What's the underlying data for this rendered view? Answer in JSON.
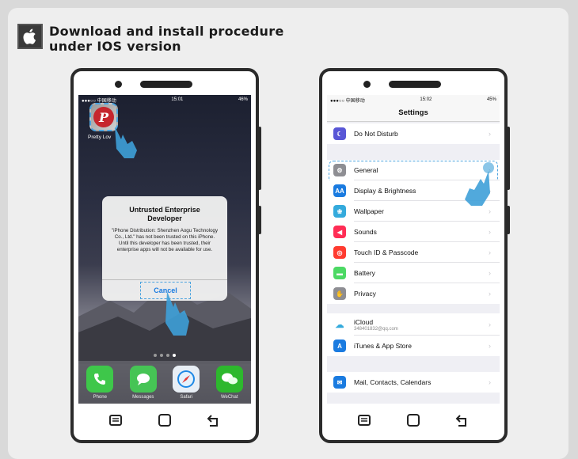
{
  "header": {
    "line1": "Download and install procedure",
    "line2": "under IOS version",
    "icon": "apple-icon"
  },
  "left_phone": {
    "status": {
      "carrier": "●●●○○ 中国移动",
      "time": "15:01",
      "battery": "46%"
    },
    "app_label": "Pretty Lov",
    "alert": {
      "title": "Untrusted Enterprise Developer",
      "body": "\"iPhone Distribution: Shenzhen Aogu Technology Co., Ltd.\" has not been trusted on this iPhone. Until this developer has been trusted, their enterprise apps will not be available for use.",
      "button": "Cancel"
    },
    "dock": [
      {
        "label": "Phone",
        "icon": "phone-icon",
        "color": "#3ec74a"
      },
      {
        "label": "Messages",
        "icon": "messages-icon",
        "color": "#46c455"
      },
      {
        "label": "Safari",
        "icon": "safari-icon",
        "color": "#e8eef5"
      },
      {
        "label": "WeChat",
        "icon": "wechat-icon",
        "color": "#2db82d"
      }
    ]
  },
  "right_phone": {
    "status": {
      "carrier": "●●●○○ 中国移动",
      "time": "15:02",
      "battery": "45%"
    },
    "title": "Settings",
    "rows": [
      {
        "label": "Do Not Disturb",
        "icon": "moon-icon",
        "color": "#5856d6"
      },
      {
        "label": "General",
        "icon": "gear-icon",
        "color": "#8e8e93"
      },
      {
        "label": "Display & Brightness",
        "icon": "brightness-icon",
        "color": "#1a7be0"
      },
      {
        "label": "Wallpaper",
        "icon": "wallpaper-icon",
        "color": "#34aadc"
      },
      {
        "label": "Sounds",
        "icon": "speaker-icon",
        "color": "#ff2d55"
      },
      {
        "label": "Touch ID & Passcode",
        "icon": "fingerprint-icon",
        "color": "#ff3b30"
      },
      {
        "label": "Battery",
        "icon": "battery-icon",
        "color": "#4cd964"
      },
      {
        "label": "Privacy",
        "icon": "hand-icon",
        "color": "#8e8e93"
      },
      {
        "label": "iCloud",
        "sub": "348401832@qq.com",
        "icon": "cloud-icon",
        "color": "#ffffff"
      },
      {
        "label": "iTunes & App Store",
        "icon": "appstore-icon",
        "color": "#1a7be0"
      },
      {
        "label": "Mail, Contacts, Calendars",
        "icon": "mail-icon",
        "color": "#1a7be0"
      }
    ]
  }
}
